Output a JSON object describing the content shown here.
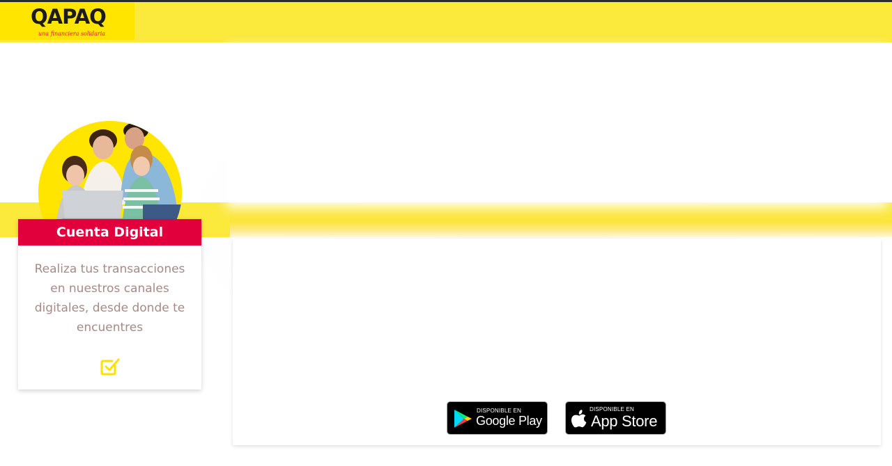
{
  "header": {
    "brand_name": "QAPAQ",
    "brand_tagline": "una financiera solidaria",
    "colors": {
      "bar": "#fbe93b",
      "logo_bg": "#ffe500"
    }
  },
  "card": {
    "title": "Cuenta Digital",
    "description": "Realiza tus transacciones en nuestros canales digitales, desde donde te encuentres",
    "icon": "check-square-icon",
    "colors": {
      "header": "#e2003c",
      "text": "#a78a86",
      "icon": "#ffe100"
    }
  },
  "store_badges": {
    "google": {
      "small": "DISPONIBLE EN",
      "big": "Google Play",
      "icon": "google-play-icon"
    },
    "apple": {
      "small": "DISPONIBLE EN",
      "big": "App Store",
      "icon": "apple-icon"
    }
  }
}
